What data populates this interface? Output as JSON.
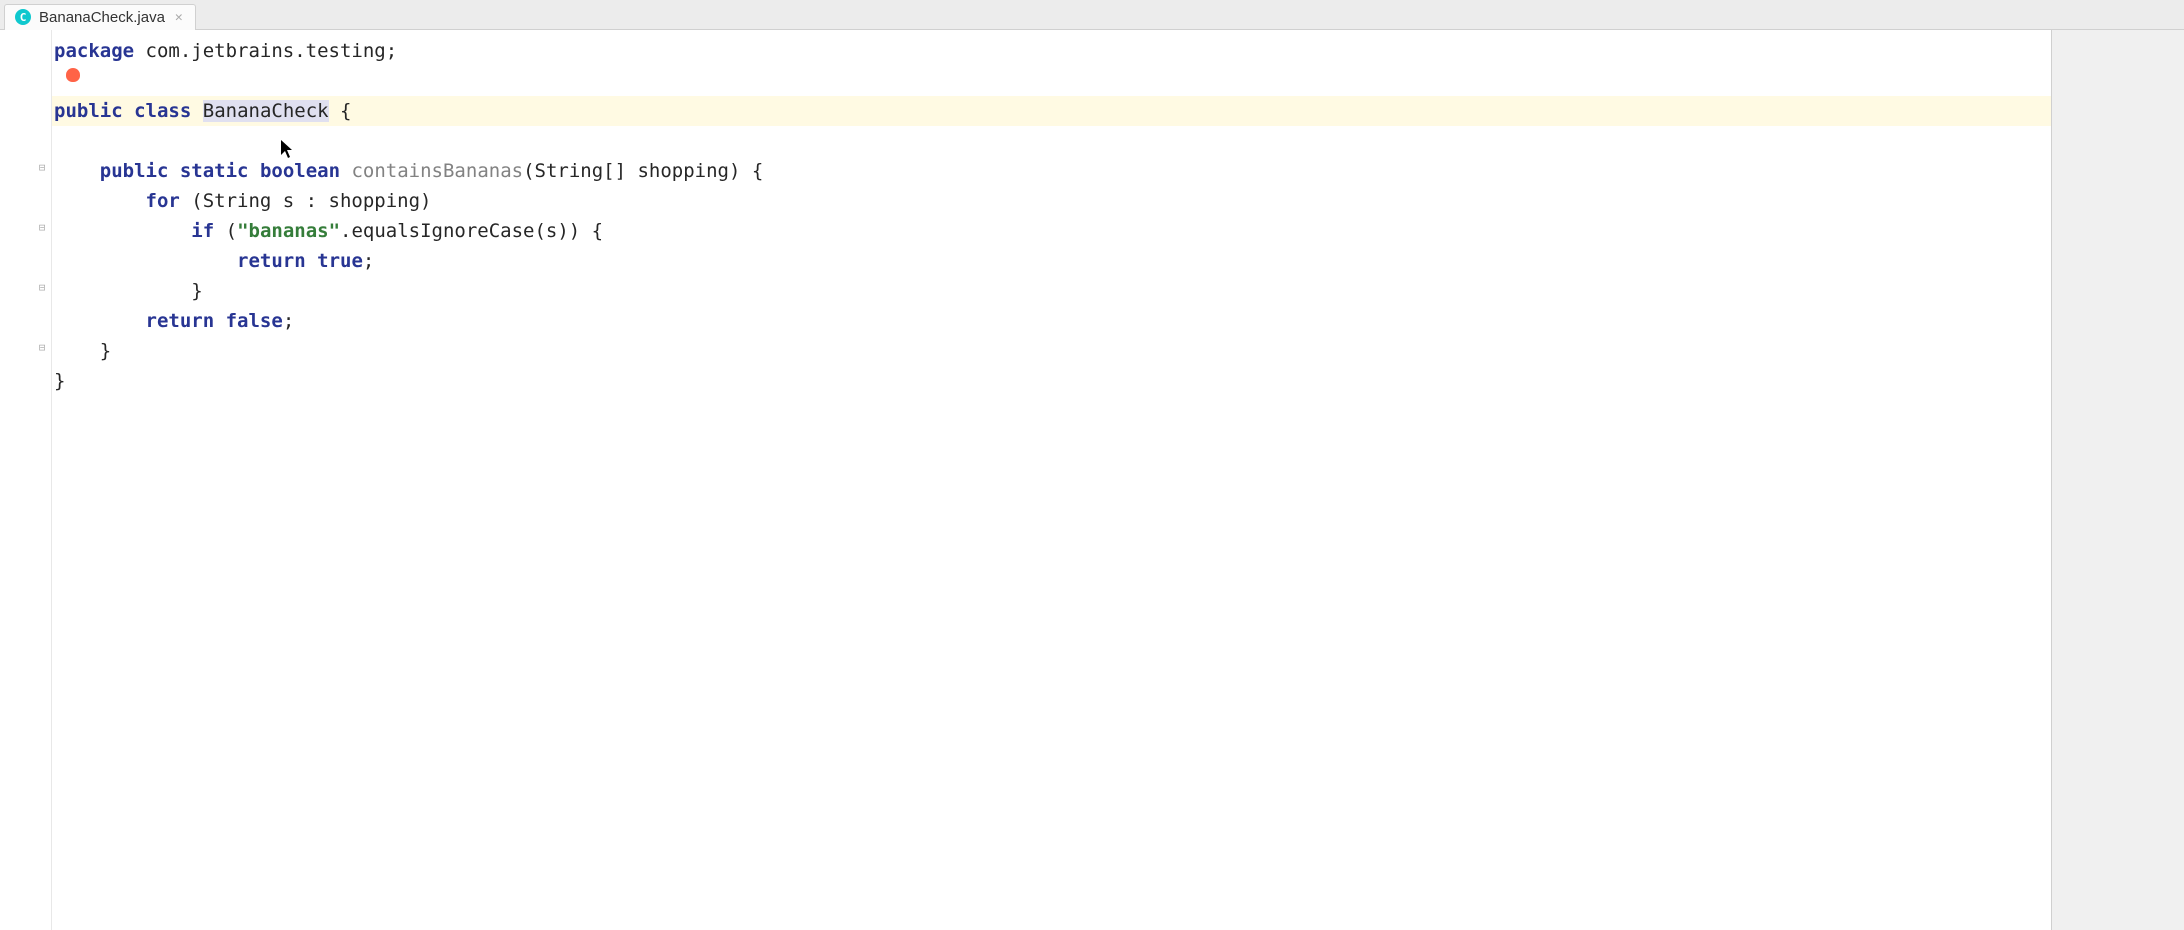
{
  "tab": {
    "filename": "BananaCheck.java",
    "icon_letter": "C"
  },
  "code": {
    "line1": {
      "kw_package": "package",
      "pkg_name": "com.jetbrains.testing",
      "semi": ";"
    },
    "line3": {
      "kw_public": "public",
      "kw_class": "class",
      "class_name": "BananaCheck",
      "brace": " {"
    },
    "line5": {
      "indent": "    ",
      "kw_public": "public",
      "kw_static": "static",
      "kw_boolean": "boolean",
      "method_name": "containsBananas",
      "params": "(String[] shopping) {"
    },
    "line6": {
      "indent": "        ",
      "kw_for": "for",
      "rest": " (String s : shopping)"
    },
    "line7": {
      "indent": "            ",
      "kw_if": "if",
      "open": " (",
      "str": "\"bananas\"",
      "rest": ".equalsIgnoreCase(s)) {"
    },
    "line8": {
      "indent": "                ",
      "kw_return": "return",
      "sp": " ",
      "kw_true": "true",
      "semi": ";"
    },
    "line9": {
      "indent": "            ",
      "brace": "}"
    },
    "line10": {
      "indent": "        ",
      "kw_return": "return",
      "sp": " ",
      "kw_false": "false",
      "semi": ";"
    },
    "line11": {
      "indent": "    ",
      "brace": "}"
    },
    "line12": {
      "brace": "}"
    }
  }
}
